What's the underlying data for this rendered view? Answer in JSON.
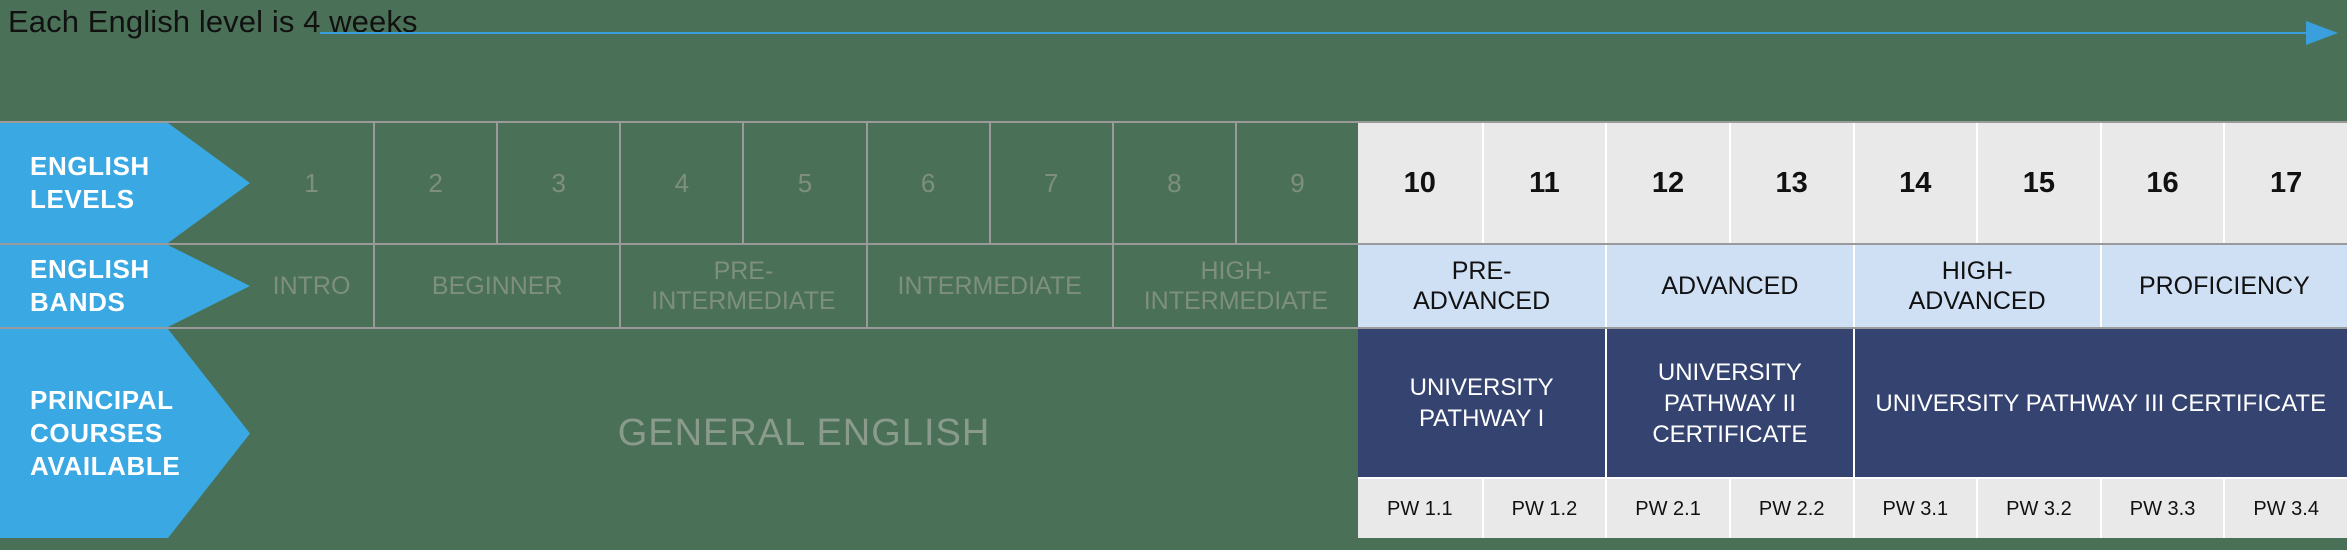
{
  "header": {
    "caption": "Each English level is 4 weeks",
    "arrow_icon": "right-arrow-icon",
    "arrow_color": "#3aa0dd"
  },
  "colors": {
    "green": "#4a7157",
    "green_text": "#7e8f7f",
    "tab_blue": "#3aa8e2",
    "light_blue": "#cfe0f5",
    "navy": "#344370",
    "light_grey": "#e9e9e9",
    "grid_line": "#9a9a9a"
  },
  "rows": {
    "levels": {
      "label_lines": [
        "ENGLISH",
        "LEVELS"
      ],
      "green_levels": [
        "1",
        "2",
        "3",
        "4",
        "5",
        "6",
        "7",
        "8",
        "9"
      ],
      "highlight_levels": [
        "10",
        "11",
        "12",
        "13",
        "14",
        "15",
        "16",
        "17"
      ]
    },
    "bands": {
      "label_lines": [
        "ENGLISH",
        "BANDS"
      ],
      "green_bands": [
        {
          "name": "INTRO",
          "span": 1
        },
        {
          "name": "BEGINNER",
          "span": 2
        },
        {
          "name": "PRE-INTERMEDIATE",
          "span": 2
        },
        {
          "name": "INTERMEDIATE",
          "span": 2
        },
        {
          "name": "HIGH-INTERMEDIATE",
          "span": 2
        }
      ],
      "highlight_bands": [
        {
          "name": "PRE-ADVANCED",
          "span": 2
        },
        {
          "name": "ADVANCED",
          "span": 2
        },
        {
          "name": "HIGH-ADVANCED",
          "span": 2
        },
        {
          "name": "PROFICIENCY",
          "span": 2
        }
      ]
    },
    "courses": {
      "label_lines": [
        "PRINCIPAL",
        "COURSES",
        "AVAILABLE"
      ],
      "general_course": "GENERAL ENGLISH",
      "pathways": [
        {
          "name": "UNIVERSITY PATHWAY I",
          "span": 2
        },
        {
          "name": "UNIVERSITY PATHWAY II CERTIFICATE",
          "span": 2
        },
        {
          "name": "UNIVERSITY PATHWAY III CERTIFICATE",
          "span": 4
        }
      ],
      "pw_modules": [
        "PW 1.1",
        "PW 1.2",
        "PW 2.1",
        "PW 2.2",
        "PW 3.1",
        "PW 3.2",
        "PW 3.3",
        "PW 3.4"
      ]
    }
  }
}
